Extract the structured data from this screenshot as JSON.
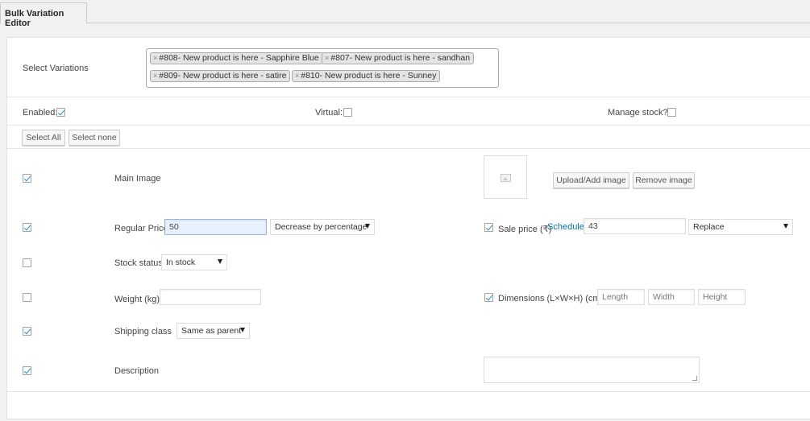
{
  "tab": {
    "label": "Bulk Variation Editor"
  },
  "variations": {
    "label": "Select Variations",
    "selected": [
      "#808- New product is here - Sapphire Blue",
      "#807- New product is here - sandhan",
      "#809- New product is here - satire",
      "#810- New product is here - Sunney"
    ],
    "remove_glyph": "×"
  },
  "flags": {
    "enabled_label": "Enabled:",
    "enabled_checked": true,
    "virtual_label": "Virtual:",
    "virtual_checked": false,
    "manage_stock_label": "Manage stock?:",
    "manage_stock_checked": false
  },
  "selection": {
    "select_all": "Select All",
    "select_none": "Select none"
  },
  "fields": {
    "main_image": {
      "label": "Main Image",
      "checked": true,
      "upload_button": "Upload/Add image",
      "remove_button": "Remove image",
      "placeholder_icon": "image-placeholder-icon"
    },
    "regular_price": {
      "label": "Regular Price",
      "checked": true,
      "value": "50",
      "mode": "Decrease by percentage"
    },
    "sale_price": {
      "label": "Sale price (₹)",
      "checked": true,
      "schedule_link": "Schedule",
      "value": "43",
      "mode": "Replace"
    },
    "stock_status": {
      "label": "Stock status",
      "checked": false,
      "value": "In stock"
    },
    "weight": {
      "label": "Weight (kg)",
      "checked": false,
      "value": ""
    },
    "dimensions": {
      "label": "Dimensions (L×W×H) (cm)",
      "checked": true,
      "length_placeholder": "Length",
      "width_placeholder": "Width",
      "height_placeholder": "Height"
    },
    "shipping_class": {
      "label": "Shipping class",
      "checked": true,
      "value": "Same as parent"
    },
    "description": {
      "label": "Description",
      "checked": true,
      "value": ""
    }
  },
  "colors": {
    "accent": "#1e8cbe",
    "link": "#0073aa",
    "focus_bg": "#e8f0fe"
  }
}
